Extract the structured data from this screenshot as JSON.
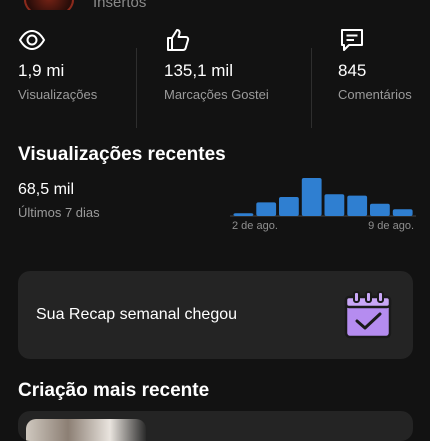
{
  "profile": {
    "username": "Insertos"
  },
  "stats": [
    {
      "value": "1,9 mi",
      "label": "Visualizações",
      "icon": "eye-icon"
    },
    {
      "value": "135,1 mil",
      "label": "Marcações Gostei",
      "icon": "thumbs-up-icon"
    },
    {
      "value": "845",
      "label": "Comentários",
      "icon": "comment-icon"
    }
  ],
  "recent_views": {
    "title": "Visualizações recentes",
    "value": "68,5 mil",
    "period": "Últimos 7 dias",
    "start_label": "2 de ago.",
    "end_label": "9 de ago."
  },
  "chart_data": {
    "type": "bar",
    "categories": [
      "2 de ago.",
      "",
      "",
      "",
      "",
      "",
      "",
      "9 de ago."
    ],
    "values": [
      0.2,
      1.0,
      1.4,
      2.8,
      1.6,
      1.5,
      0.9,
      0.5
    ],
    "title": "",
    "xlabel": "",
    "ylabel": "",
    "grid": false,
    "bar_color": "#2f7fd1"
  },
  "recap": {
    "text": "Sua Recap semanal chegou",
    "icon": "calendar-check-icon",
    "accent": "#b58cf0"
  },
  "latest": {
    "title": "Criação mais recente"
  },
  "colors": {
    "background": "#121212",
    "card": "#242424",
    "muted_text": "#9b9b9b"
  }
}
